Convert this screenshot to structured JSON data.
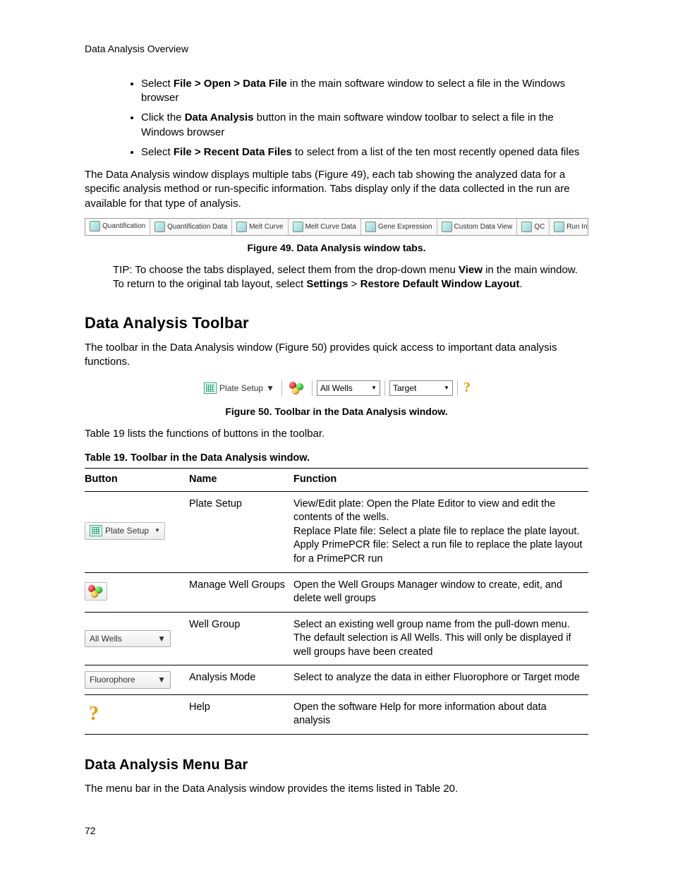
{
  "header": "Data Analysis Overview",
  "bullets": [
    {
      "pre": "Select ",
      "b": "File > Open > Data File",
      "post": " in the main software window to select a file in the Windows browser"
    },
    {
      "pre": "Click the ",
      "b": "Data Analysis",
      "post": " button in the main software window toolbar to select a file in the Windows browser"
    },
    {
      "pre": "Select ",
      "b": "File > Recent Data Files",
      "post": " to select from a list of the ten most recently opened data files"
    }
  ],
  "para1": "The Data Analysis window displays multiple tabs (Figure 49), each tab showing the analyzed data for a specific analysis method or run-specific information. Tabs display only if the data collected in the run are available for that type of analysis.",
  "fig49_caption": "Figure 49. Data Analysis window tabs.",
  "tabs": [
    "Quantification",
    "Quantification Data",
    "Melt Curve",
    "Melt Curve Data",
    "Gene Expression",
    "Custom Data View",
    "QC",
    "Run Information"
  ],
  "tip_pre": "TIP: To choose the tabs displayed, select them from the drop-down menu ",
  "tip_b1": "View",
  "tip_mid": " in the main window. To return to the original tab layout, select ",
  "tip_b2": "Settings",
  "tip_gt": " > ",
  "tip_b3": "Restore Default Window Layout",
  "tip_end": ".",
  "section1": "Data Analysis Toolbar",
  "para2": "The toolbar in the Data Analysis window (Figure 50) provides quick access to important data analysis functions.",
  "toolbar": {
    "plate_setup": "Plate Setup",
    "all_wells": "All Wells",
    "target": "Target"
  },
  "fig50_caption": "Figure 50. Toolbar in the Data Analysis window.",
  "para3": "Table 19 lists the functions of buttons in the toolbar.",
  "table_caption": "Table 19. Toolbar in the Data Analysis window.",
  "table_headers": {
    "c1": "Button",
    "c2": "Name",
    "c3": "Function"
  },
  "rows": [
    {
      "btn_label": "Plate Setup",
      "btn_type": "plate",
      "name": "Plate Setup",
      "func": "View/Edit plate: Open the Plate Editor to view and edit the contents of the wells.\nReplace Plate file: Select a plate file to replace the plate layout.\nApply PrimePCR file: Select a run file to replace the plate layout for a PrimePCR run"
    },
    {
      "btn_label": "",
      "btn_type": "wells",
      "name": "Manage Well Groups",
      "func": "Open the Well Groups Manager window to create, edit, and delete well groups"
    },
    {
      "btn_label": "All Wells",
      "btn_type": "select",
      "name": "Well Group",
      "func": "Select an existing well group name from the pull-down menu. The default selection is All Wells. This will only be displayed if well groups have been created"
    },
    {
      "btn_label": "Fluorophore",
      "btn_type": "select",
      "name": "Analysis Mode",
      "func": "Select to analyze the data in either Fluorophore or Target mode"
    },
    {
      "btn_label": "?",
      "btn_type": "help",
      "name": "Help",
      "func": "Open the software Help for more information about data analysis"
    }
  ],
  "section2": "Data Analysis Menu Bar",
  "para4": "The menu bar in the Data Analysis window provides the items listed in Table 20.",
  "page_num": "72"
}
